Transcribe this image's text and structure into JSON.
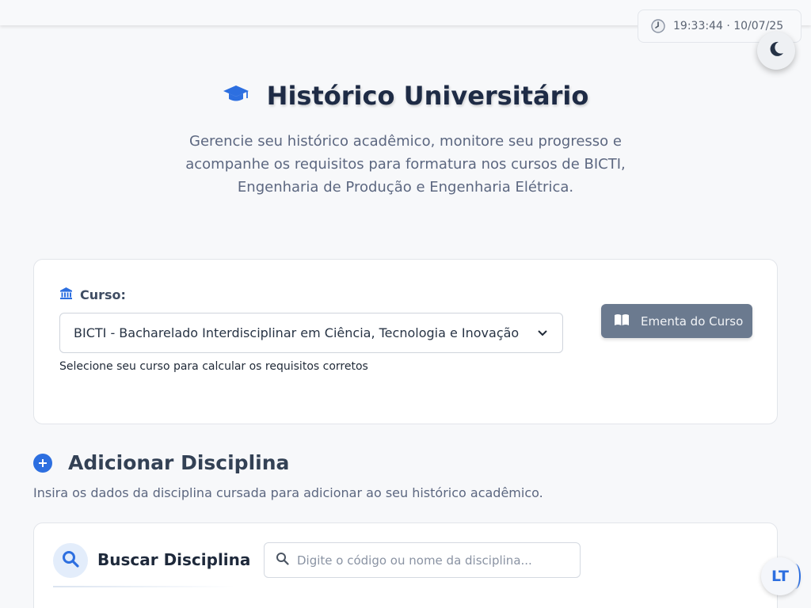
{
  "header": {
    "clock_text": "19:33:44 · 10/07/25",
    "clock_icon": "clock-icon",
    "theme_icon": "moon-icon"
  },
  "hero": {
    "icon": "graduation-cap-icon",
    "title": "Histórico Universitário",
    "description": "Gerencie seu histórico acadêmico, monitore seu progresso e acompanhe os requisitos para formatura nos cursos de BICTI, Engenharia de Produção e Engenharia Elétrica."
  },
  "course": {
    "label": "Curso:",
    "label_icon": "university-icon",
    "selected": "BICTI - Bacharelado Interdisciplinar em Ciência, Tecnologia e Inovação",
    "help": "Selecione seu curso para calcular os requisitos corretos",
    "ementa_label": "Ementa do Curso",
    "ementa_icon": "book-open-icon"
  },
  "add_section": {
    "title": "Adicionar Disciplina",
    "description": "Insira os dados da disciplina cursada para adicionar ao seu histórico acadêmico."
  },
  "search": {
    "title": "Buscar Disciplina",
    "placeholder": "Digite o código ou nome da disciplina..."
  },
  "badge": {
    "text": "LT"
  },
  "colors": {
    "accent": "#2d6fe0",
    "button_gray": "#6b7a8f",
    "background": "#f7f8fa"
  }
}
